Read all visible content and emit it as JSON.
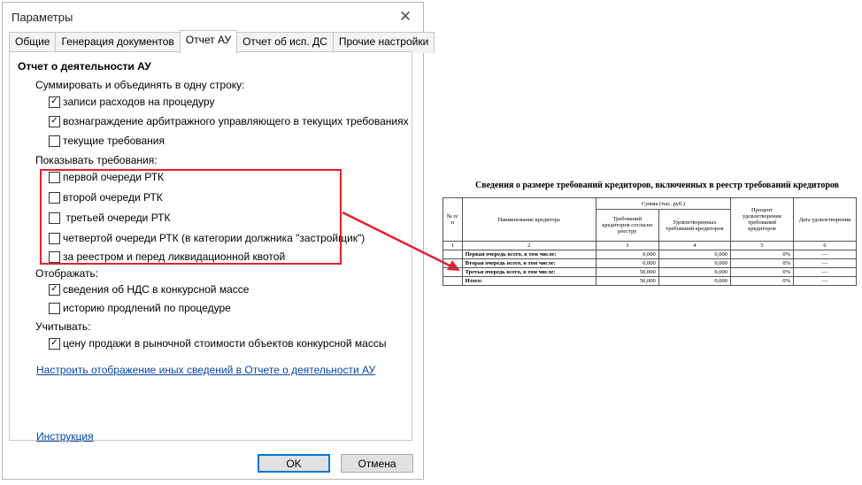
{
  "dialog": {
    "title": "Параметры",
    "close": "✕",
    "tabs": [
      "Общие",
      "Генерация документов",
      "Отчет АУ",
      "Отчет об исп. ДС",
      "Прочие настройки"
    ],
    "heading": "Отчет о деятельности АУ",
    "groups": {
      "summ": "Суммировать и объединять в одну строку:",
      "show": "Показывать требования:",
      "display": "Отображать:",
      "consider": "Учитывать:"
    },
    "checks": {
      "c1": {
        "label": "записи расходов на процедуру",
        "mark": "✓"
      },
      "c2": {
        "label": "вознаграждение арбитражного управляющего в текущих требованиях",
        "mark": "✓"
      },
      "c3": {
        "label": "текущие требования",
        "mark": ""
      },
      "c4": {
        "label": "первой очереди РТК",
        "mark": ""
      },
      "c5": {
        "label": "второй очереди РТК",
        "mark": ""
      },
      "c6": {
        "label": " третьей очереди РТК",
        "mark": ""
      },
      "c7": {
        "label": "четвертой очереди РТК (в категории должника \"застройщик\")",
        "mark": ""
      },
      "c8": {
        "label": "за реестром и перед ликвидационной квотой",
        "mark": ""
      },
      "c9": {
        "label": "сведения об НДС в конкурсной массе",
        "mark": "✓"
      },
      "c10": {
        "label": "историю продлений по процедуре",
        "mark": ""
      },
      "c11": {
        "label": "цену продажи в рыночной стоимости объектов конкурсной массы",
        "mark": "✓"
      }
    },
    "link_config": "Настроить отображение иных сведений в Отчете о деятельности АУ",
    "link_help": "Инструкция",
    "ok": "OK",
    "cancel": "Отмена"
  },
  "report": {
    "title": "Сведения о размере требований кредиторов, включенных в реестр требований кредиторов",
    "headers": {
      "num": "№ п/п",
      "creditor": "Наименование кредитора",
      "sum_group": "Сумма (тыс. руб.)",
      "claims": "Требований кредиторов согласно реестру",
      "satisfied": "Удовлетворенных требований кредиторов",
      "percent": "Процент удовлетворения требований кредиторов",
      "date": "Дата удовлетворения"
    },
    "colnums": [
      "1",
      "2",
      "3",
      "4",
      "5",
      "6"
    ],
    "rows": [
      {
        "num": "",
        "name": "Первая очередь всего, в том числе:",
        "claims": "0,000",
        "satisfied": "0,000",
        "percent": "0%",
        "date": "—"
      },
      {
        "num": "",
        "name": "Вторая очередь всего, в том числе:",
        "claims": "0,000",
        "satisfied": "0,000",
        "percent": "0%",
        "date": "—"
      },
      {
        "num": "",
        "name": "Третья очередь всего, в том числе:",
        "claims": "50,000",
        "satisfied": "0,000",
        "percent": "0%",
        "date": "—"
      },
      {
        "num": "",
        "name": "Итого:",
        "claims": "50,000",
        "satisfied": "0,000",
        "percent": "0%",
        "date": "—"
      }
    ]
  },
  "colors": {
    "highlight": "#e5202a",
    "link": "#0645ad",
    "default_button": "#0078d7"
  }
}
